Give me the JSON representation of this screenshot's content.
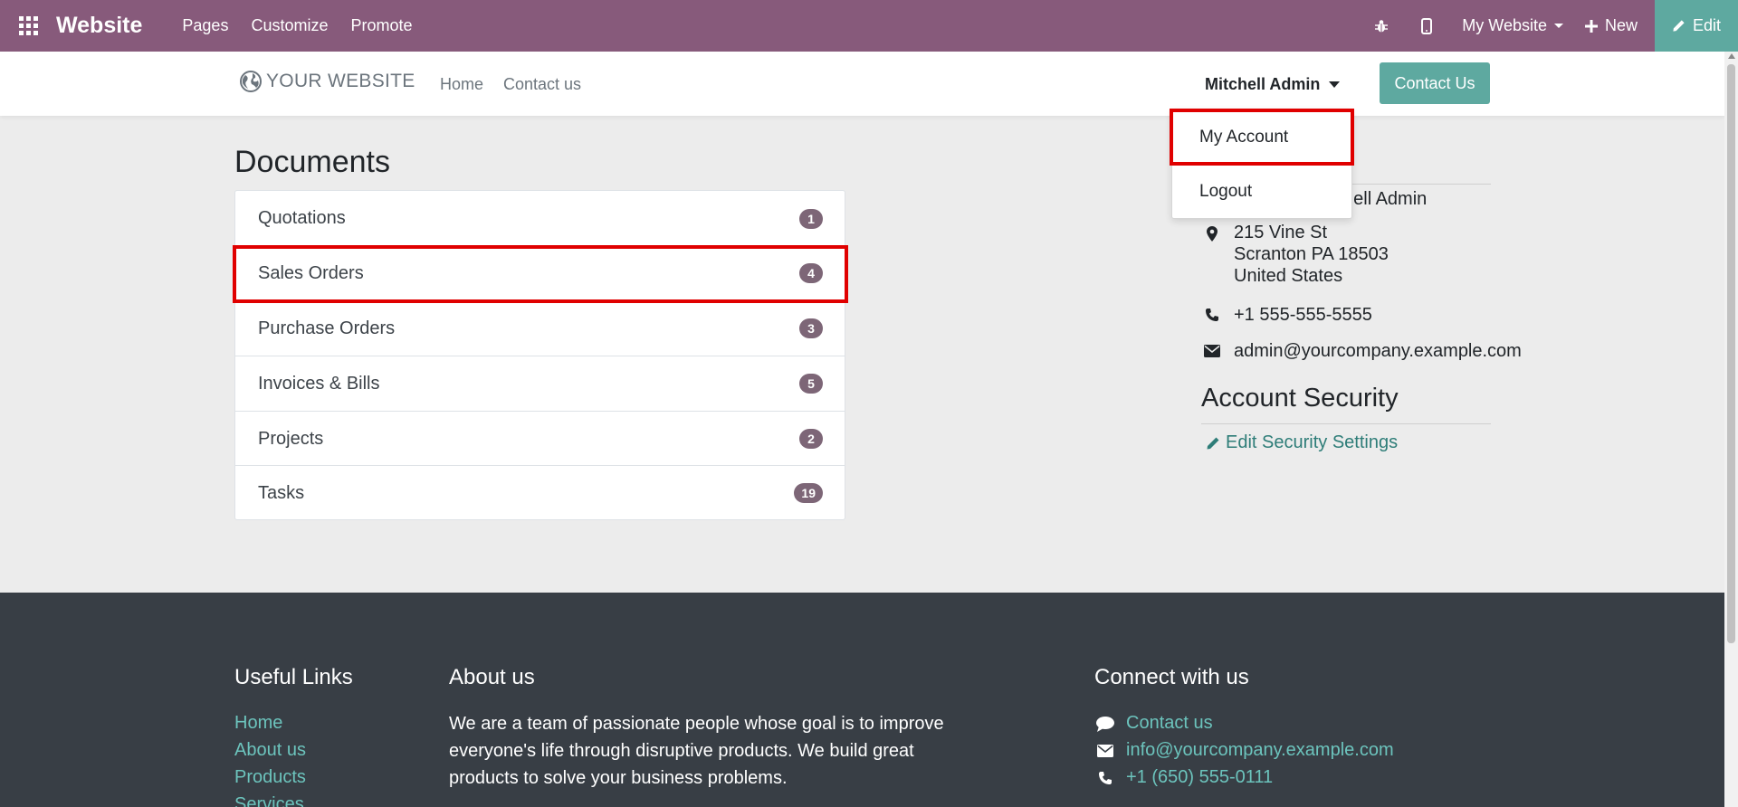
{
  "topbar": {
    "brand": "Website",
    "menu": [
      "Pages",
      "Customize",
      "Promote"
    ],
    "site_selector": "My Website",
    "new_label": "New",
    "edit_label": "Edit",
    "bg_color": "#875a7b"
  },
  "header": {
    "logo_text": "YOUR WEBSITE",
    "nav": [
      "Home",
      "Contact us"
    ],
    "user_name": "Mitchell Admin",
    "contact_button": "Contact Us"
  },
  "user_dropdown": {
    "items": [
      "My Account",
      "Logout"
    ]
  },
  "documents": {
    "title": "Documents",
    "items": [
      {
        "label": "Quotations",
        "count": "1"
      },
      {
        "label": "Sales Orders",
        "count": "4"
      },
      {
        "label": "Purchase Orders",
        "count": "3"
      },
      {
        "label": "Invoices & Bills",
        "count": "5"
      },
      {
        "label": "Projects",
        "count": "2"
      },
      {
        "label": "Tasks",
        "count": "19"
      }
    ]
  },
  "details": {
    "name_partial": "chell Admin",
    "address_lines": [
      "215 Vine St",
      "Scranton PA 18503",
      "United States"
    ],
    "phone": "+1 555-555-5555",
    "email": "admin@yourcompany.example.com"
  },
  "security": {
    "title": "Account Security",
    "edit_link": "Edit Security Settings"
  },
  "footer": {
    "useful_links_title": "Useful Links",
    "useful_links": [
      "Home",
      "About us",
      "Products",
      "Services"
    ],
    "about_title": "About us",
    "about_text": "We are a team of passionate people whose goal is to improve everyone's life through disruptive products. We build great products to solve your business problems.",
    "connect_title": "Connect with us",
    "connect_contact": "Contact us",
    "connect_email": "info@yourcompany.example.com",
    "connect_phone": "+1 (650) 555-0111",
    "link_color": "#6cc4bd"
  },
  "icons": {
    "apps": "apps-grid-icon",
    "debug": "bug-icon",
    "mobile": "mobile-icon",
    "new": "plus-icon",
    "edit": "pencil-icon",
    "address": "map-marker-icon",
    "phone": "phone-icon",
    "email": "envelope-icon",
    "chat": "comment-icon"
  },
  "highlight_color": "#e00000"
}
